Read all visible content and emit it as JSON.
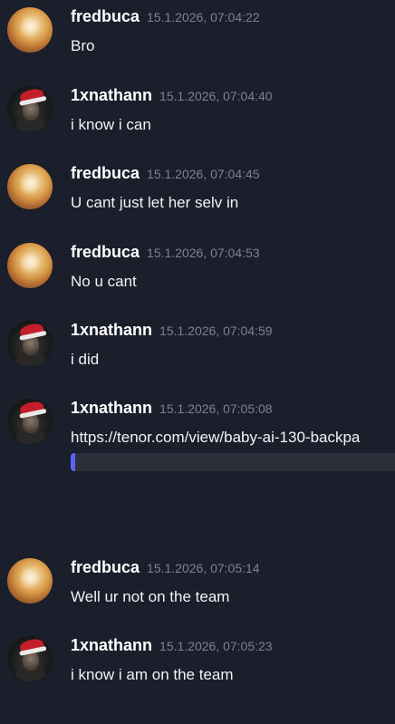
{
  "messages": [
    {
      "author": "fredbuca",
      "timestamp": "15.1.2026, 07:04:22",
      "text": "Bro"
    },
    {
      "author": "1xnathann",
      "timestamp": "15.1.2026, 07:04:40",
      "text": "i know i can"
    },
    {
      "author": "fredbuca",
      "timestamp": "15.1.2026, 07:04:45",
      "text": "U cant just let her selv in"
    },
    {
      "author": "fredbuca",
      "timestamp": "15.1.2026, 07:04:53",
      "text": "No u cant"
    },
    {
      "author": "1xnathann",
      "timestamp": "15.1.2026, 07:04:59",
      "text": "i did"
    },
    {
      "author": "1xnathann",
      "timestamp": "15.1.2026, 07:05:08",
      "text": "https://tenor.com/view/baby-ai-130-backpa"
    },
    {
      "author": "fredbuca",
      "timestamp": "15.1.2026, 07:05:14",
      "text": "Well ur not on the team"
    },
    {
      "author": "1xnathann",
      "timestamp": "15.1.2026, 07:05:23",
      "text": "i know i am on the team"
    }
  ],
  "colors": {
    "background": "#1b1e2b",
    "username": "#ffffff",
    "timestamp": "#7e828f",
    "embed_accent": "#5865f2"
  }
}
